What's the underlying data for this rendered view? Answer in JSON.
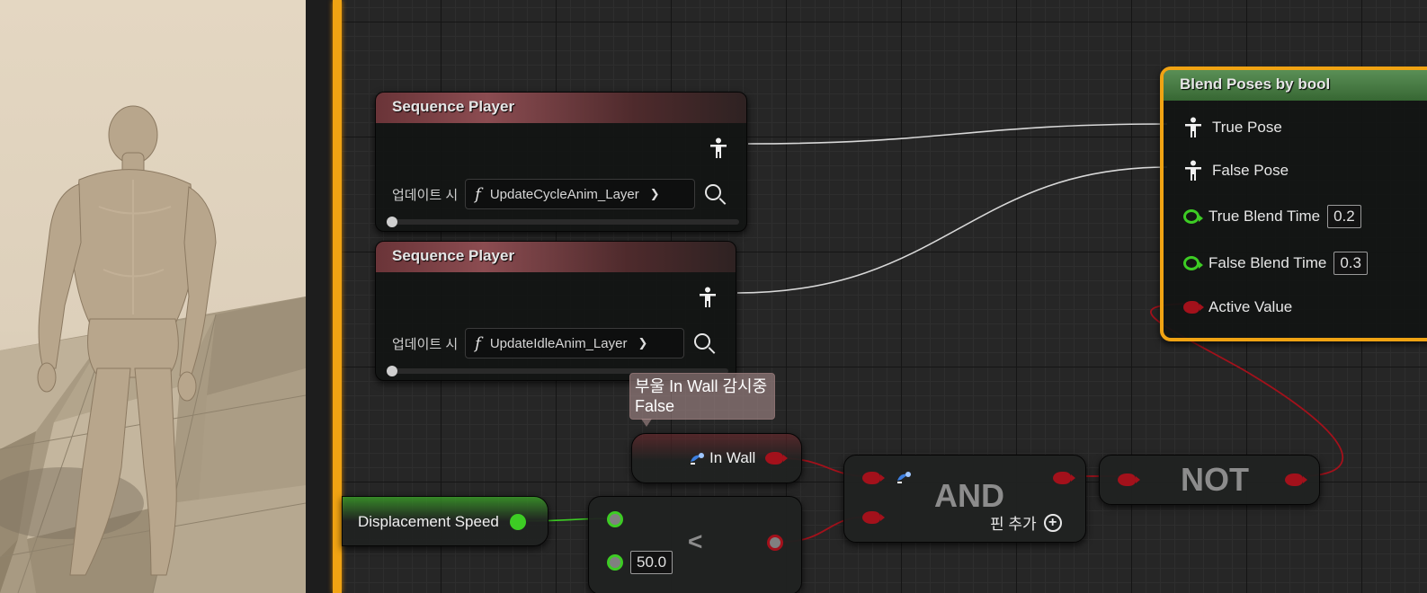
{
  "seq1": {
    "title": "Sequence Player",
    "update_label": "업데이트 시",
    "function": "UpdateCycleAnim_Layer"
  },
  "seq2": {
    "title": "Sequence Player",
    "update_label": "업데이트 시",
    "function": "UpdateIdleAnim_Layer"
  },
  "blend": {
    "title": "Blend Poses by bool",
    "true_pose": "True Pose",
    "false_pose": "False Pose",
    "true_blend_time_label": "True Blend Time",
    "true_blend_time": "0.2",
    "false_blend_time_label": "False Blend Time",
    "false_blend_time": "0.3",
    "active_value": "Active Value"
  },
  "watch_comment": {
    "line1": "부울 In Wall 감시중",
    "line2": "False"
  },
  "in_wall": {
    "label": "In Wall"
  },
  "and_node": {
    "label": "AND",
    "add_pin": "핀 추가"
  },
  "not_node": {
    "label": "NOT"
  },
  "displacement": {
    "label": "Displacement Speed"
  },
  "less_node": {
    "label": "<",
    "value": "50.0"
  },
  "colors": {
    "graph_border": "#f0a313",
    "bool_pin": "#a3111b",
    "float_pin": "#3dcc24",
    "blend_header": "#3f7a3a"
  }
}
